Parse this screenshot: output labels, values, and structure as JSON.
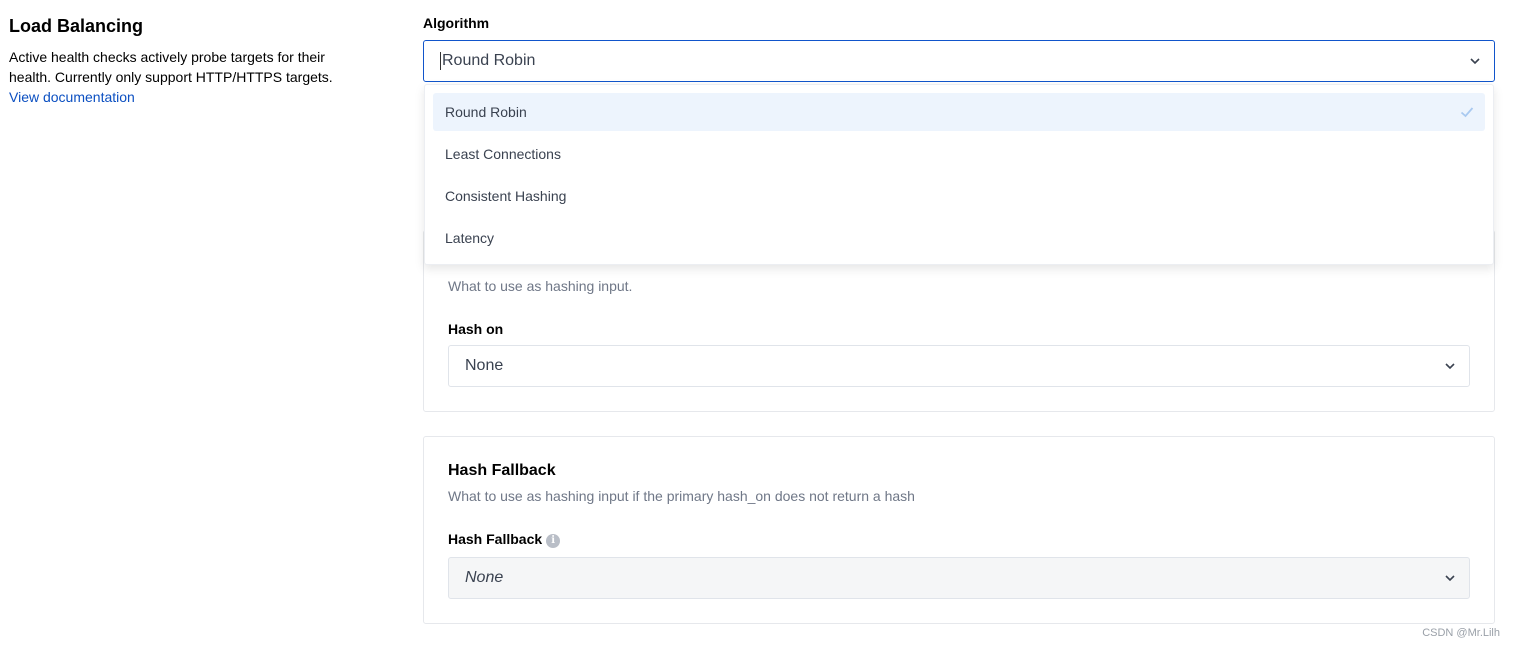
{
  "section": {
    "title": "Load Balancing",
    "description": "Active health checks actively probe targets for their health. Currently only support HTTP/HTTPS targets.",
    "link_label": "View documentation"
  },
  "algorithm": {
    "label": "Algorithm",
    "value": "Round Robin",
    "options": [
      "Round Robin",
      "Least Connections",
      "Consistent Hashing",
      "Latency"
    ],
    "selected_index": 0
  },
  "hash_on_card": {
    "help": "What to use as hashing input.",
    "field_label": "Hash on",
    "value": "None"
  },
  "hash_fallback_card": {
    "title": "Hash Fallback",
    "help": "What to use as hashing input if the primary hash_on does not return a hash",
    "field_label": "Hash Fallback",
    "value": "None"
  },
  "watermark": "CSDN @Mr.Lilh",
  "colors": {
    "accent": "#1155cb",
    "link": "#0b4fc1",
    "selected_bg": "#edf4fd",
    "muted_text": "#6f7787"
  }
}
